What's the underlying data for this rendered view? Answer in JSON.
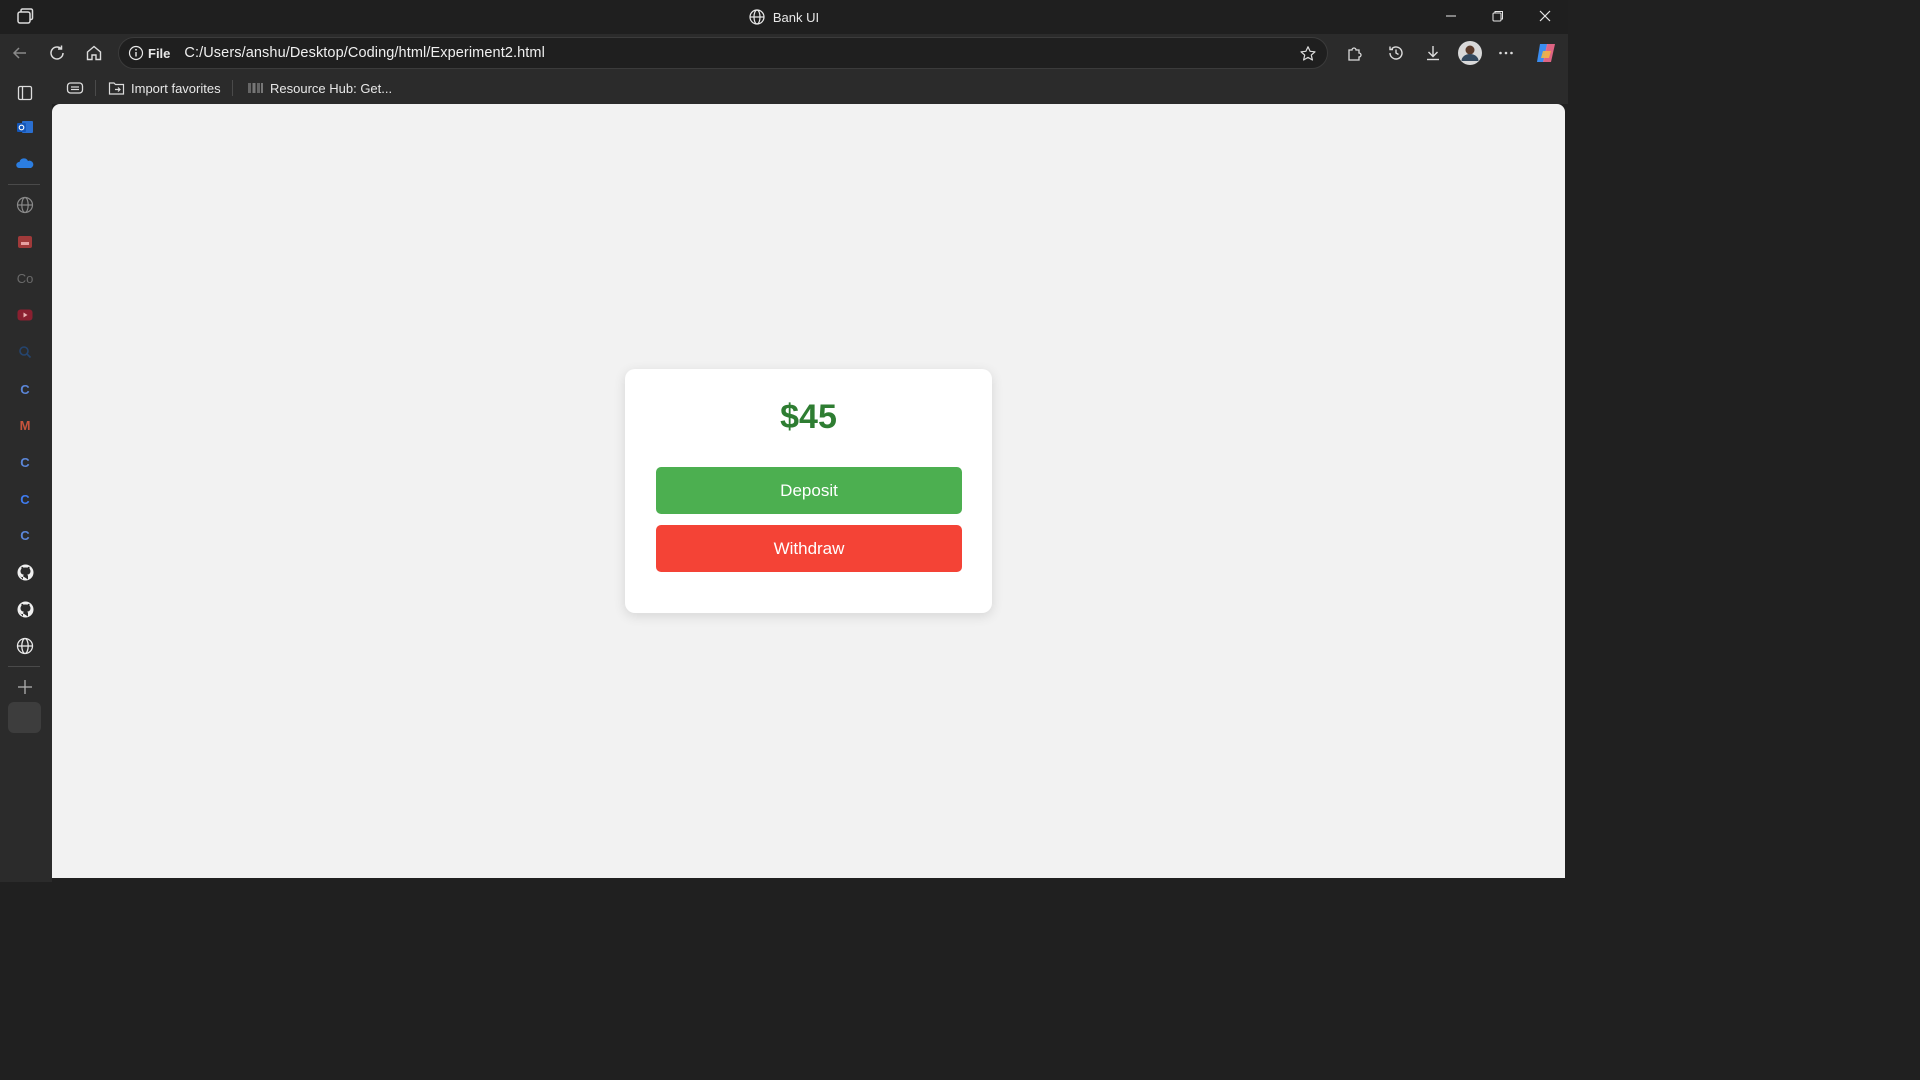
{
  "window": {
    "title": "Bank UI",
    "title_icon": "globe-icon",
    "controls": [
      "minimize-icon",
      "restore-icon",
      "close-icon"
    ]
  },
  "toolbar": {
    "back_icon": "back-arrow-icon",
    "refresh_icon": "refresh-icon",
    "home_icon": "home-icon",
    "address": {
      "scheme_label": "File",
      "url": "C:/Users/anshu/Desktop/Coding/html/Experiment2.html"
    },
    "right_icons": [
      "star-icon",
      "extensions-icon",
      "history-icon",
      "download-icon",
      "profile-avatar",
      "more-icon",
      "copilot-icon"
    ]
  },
  "favorites": {
    "items": [
      {
        "label": "Import favorites",
        "icon": "import-icon"
      },
      {
        "label": "Resource Hub: Get...",
        "icon": "resource-hub-icon"
      }
    ]
  },
  "sidebar": {
    "items": [
      {
        "name": "tabs-icon"
      },
      {
        "name": "outlook-icon"
      },
      {
        "name": "onedrive-icon"
      },
      {
        "name": "globe-icon"
      },
      {
        "name": "app-icon"
      },
      {
        "name": "co-text-icon",
        "text": "Co"
      },
      {
        "name": "youtube-icon"
      },
      {
        "name": "search-icon"
      },
      {
        "name": "c-app-icon",
        "text": "C"
      },
      {
        "name": "gmail-icon",
        "text": "M"
      },
      {
        "name": "c-app-icon",
        "text": "C"
      },
      {
        "name": "c-app-icon",
        "text": "C"
      },
      {
        "name": "c-app-icon",
        "text": "C"
      },
      {
        "name": "github-icon"
      },
      {
        "name": "github-icon"
      },
      {
        "name": "globe-icon"
      }
    ],
    "add_icon": "plus-icon"
  },
  "page": {
    "balance": "$45",
    "deposit_label": "Deposit",
    "withdraw_label": "Withdraw",
    "colors": {
      "balance": "#2e7d32",
      "deposit": "#4caf50",
      "withdraw": "#f44336",
      "background": "#f2f2f2"
    }
  }
}
